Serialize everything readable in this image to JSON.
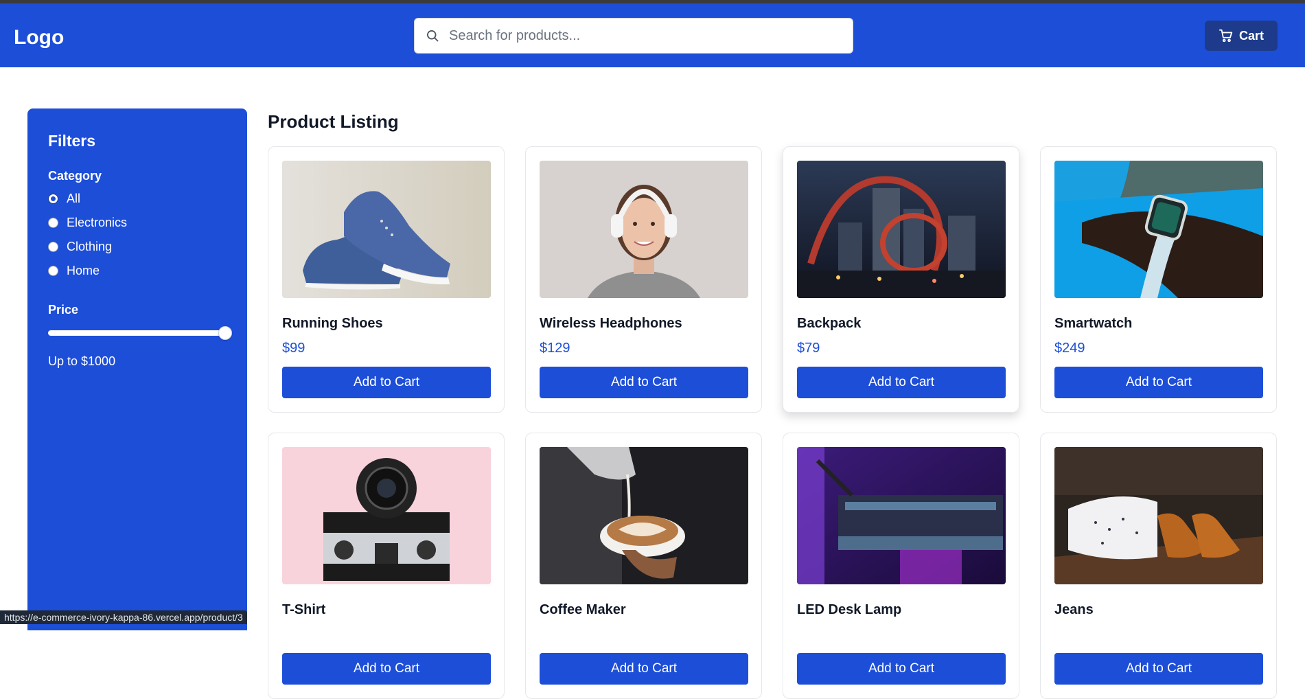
{
  "header": {
    "logo": "Logo",
    "search_placeholder": "Search for products...",
    "cart_label": "Cart"
  },
  "sidebar": {
    "title": "Filters",
    "category_title": "Category",
    "categories": [
      {
        "label": "All",
        "checked": true
      },
      {
        "label": "Electronics",
        "checked": false
      },
      {
        "label": "Clothing",
        "checked": false
      },
      {
        "label": "Home",
        "checked": false
      }
    ],
    "price_title": "Price",
    "price_slider_fraction": 1.0,
    "price_note": "Up to $1000"
  },
  "main": {
    "title": "Product Listing",
    "add_label": "Add to Cart",
    "products": [
      {
        "name": "Running Shoes",
        "price": "$99",
        "image": "blue-sneakers-photo"
      },
      {
        "name": "Wireless Headphones",
        "price": "$129",
        "image": "woman-with-headphones-photo"
      },
      {
        "name": "Backpack",
        "price": "$79",
        "image": "city-rollercoaster-night-photo"
      },
      {
        "name": "Smartwatch",
        "price": "$249",
        "image": "smartwatch-on-wrist-photo"
      },
      {
        "name": "T-Shirt",
        "price": "",
        "image": "camera-on-pink-photo"
      },
      {
        "name": "Coffee Maker",
        "price": "",
        "image": "latte-art-cup-photo"
      },
      {
        "name": "LED Desk Lamp",
        "price": "",
        "image": "music-studio-purple-photo"
      },
      {
        "name": "Jeans",
        "price": "",
        "image": "shoes-and-shirts-photo"
      }
    ]
  },
  "status_bar": {
    "url": "https://e-commerce-ivory-kappa-86.vercel.app/product/3"
  },
  "colors": {
    "brand": "#1d4ed8",
    "cart_button": "#1e3a8a"
  }
}
